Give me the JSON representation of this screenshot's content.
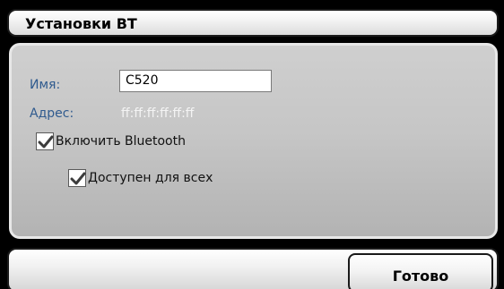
{
  "window": {
    "title": "Установки BT"
  },
  "form": {
    "name_label": "Имя:",
    "name_value": "C520",
    "address_label": "Адрес:",
    "address_value": "ff:ff:ff:ff:ff:ff"
  },
  "options": {
    "bluetooth": {
      "label": "Включить Bluetooth",
      "checked": true,
      "icon": "checkmark-icon"
    },
    "visible": {
      "label": "Доступен для всех",
      "checked": true,
      "icon": "checkmark-icon"
    }
  },
  "footer": {
    "done_label": "Готово"
  },
  "colors": {
    "field_label": "#2f5a8e",
    "address_value": "#f4f4f4",
    "checkmark": "#3c3c3c"
  }
}
